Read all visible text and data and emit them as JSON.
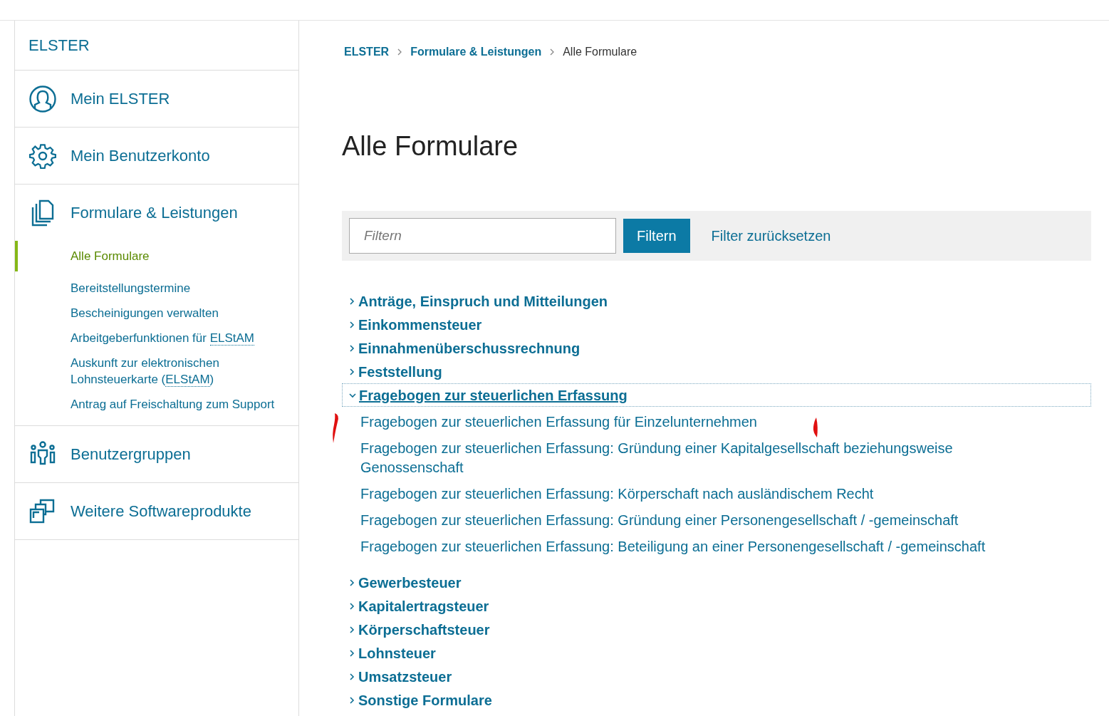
{
  "sidebar": {
    "title": "ELSTER",
    "items": [
      {
        "kind": "person",
        "label": "Mein ELSTER"
      },
      {
        "kind": "gear",
        "label": "Mein Benutzerkonto"
      },
      {
        "kind": "pages",
        "label": "Formulare & Leistungen",
        "children": [
          {
            "label": "Alle Formulare",
            "selected": true
          },
          {
            "label": "Bereitstellungstermine",
            "selected": false
          },
          {
            "label": "Bescheinigungen verwalten",
            "selected": false
          },
          {
            "label": "Arbeitgeberfunktionen für ",
            "abbr": "ELStAM",
            "selected": false
          },
          {
            "label": "Auskunft zur elektronischen Lohnsteuerkarte (",
            "abbr": "ELStAM",
            "after": ")",
            "selected": false
          },
          {
            "label": "Antrag auf Freischaltung zum Support",
            "selected": false
          }
        ]
      },
      {
        "kind": "group",
        "label": "Benutzergruppen"
      },
      {
        "kind": "windows",
        "label": "Weitere Softwareprodukte"
      }
    ]
  },
  "breadcrumb": [
    "ELSTER",
    "Formulare & Leistungen",
    "Alle Formulare"
  ],
  "heading": "Alle Formulare",
  "filter": {
    "placeholder": "Filtern",
    "button": "Filtern",
    "reset": "Filter zurücksetzen"
  },
  "categories": [
    {
      "label": "Anträge, Einspruch und Mitteilungen",
      "expanded": false
    },
    {
      "label": "Einkommensteuer",
      "expanded": false
    },
    {
      "label": "Einnahmenüberschussrechnung",
      "expanded": false
    },
    {
      "label": "Feststellung",
      "expanded": false
    },
    {
      "label": "Fragebogen zur steuerlichen Erfassung",
      "expanded": true,
      "children": [
        "Fragebogen zur steuerlichen Erfassung für Einzelunternehmen",
        "Fragebogen zur steuerlichen Erfassung: Gründung einer Kapitalgesellschaft beziehungsweise Genossenschaft",
        "Fragebogen zur steuerlichen Erfassung: Körperschaft nach ausländischem Recht",
        "Fragebogen zur steuerlichen Erfassung: Gründung einer Personengesellschaft / -gemeinschaft",
        "Fragebogen zur steuerlichen Erfassung: Beteiligung an einer Personengesellschaft / -gemeinschaft"
      ]
    },
    {
      "label": "Gewerbesteuer",
      "expanded": false
    },
    {
      "label": "Kapitalertragsteuer",
      "expanded": false
    },
    {
      "label": "Körperschaftsteuer",
      "expanded": false
    },
    {
      "label": "Lohnsteuer",
      "expanded": false
    },
    {
      "label": "Umsatzsteuer",
      "expanded": false
    },
    {
      "label": "Sonstige Formulare",
      "expanded": false
    }
  ]
}
